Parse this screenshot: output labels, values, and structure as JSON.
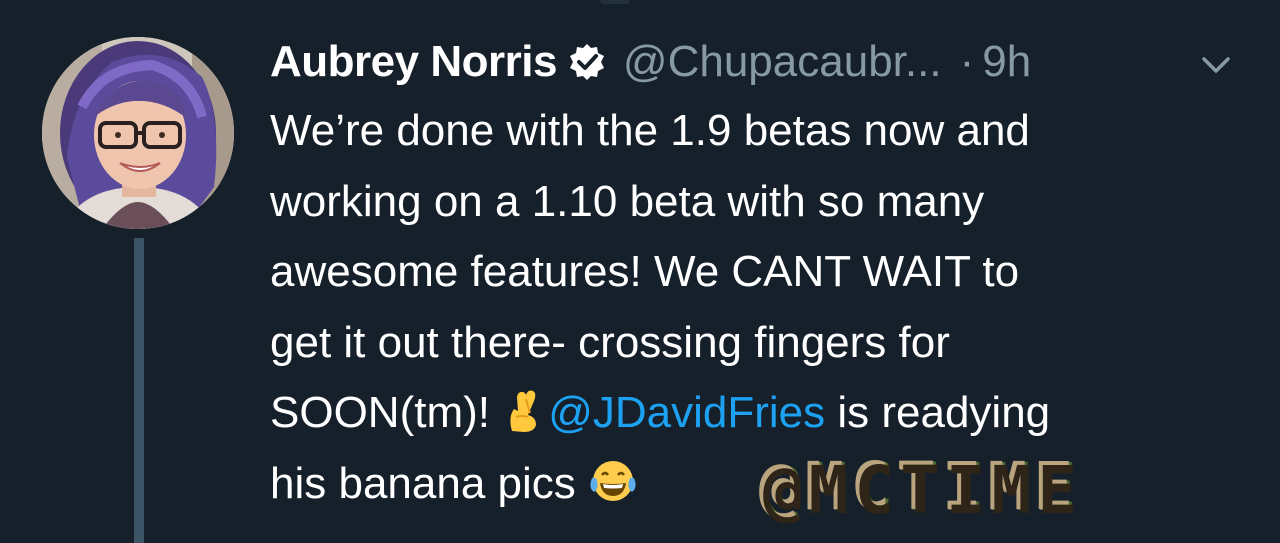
{
  "author": {
    "name": "Aubrey Norris",
    "handle": "@Chupacaubr...",
    "separator": "·",
    "time": "9h",
    "verified": true,
    "avatar_icon": "profile-photo"
  },
  "tweet": {
    "lines": [
      "We’re done with the 1.9 betas now and",
      "working on a 1.10 beta with so many",
      "awesome features! We CANT WAIT to",
      "get it out there- crossing fingers for"
    ],
    "line5_before": "SOON(tm)! ",
    "line5_emoji": "crossed-fingers-emoji",
    "mention": "@JDavidFries",
    "line5_after": " is readying",
    "line6_text": "his banana pics ",
    "line6_emoji": "tears-of-joy-emoji"
  },
  "watermark": {
    "text": "@MCTIME"
  },
  "colors": {
    "background": "#15202b",
    "text": "#ffffff",
    "muted": "#8899a6",
    "link": "#1da1f2",
    "thread_line": "#3d5466",
    "verified": "#ffffff"
  },
  "icons": {
    "verified": "verified-badge-icon",
    "menu": "chevron-down-icon"
  }
}
